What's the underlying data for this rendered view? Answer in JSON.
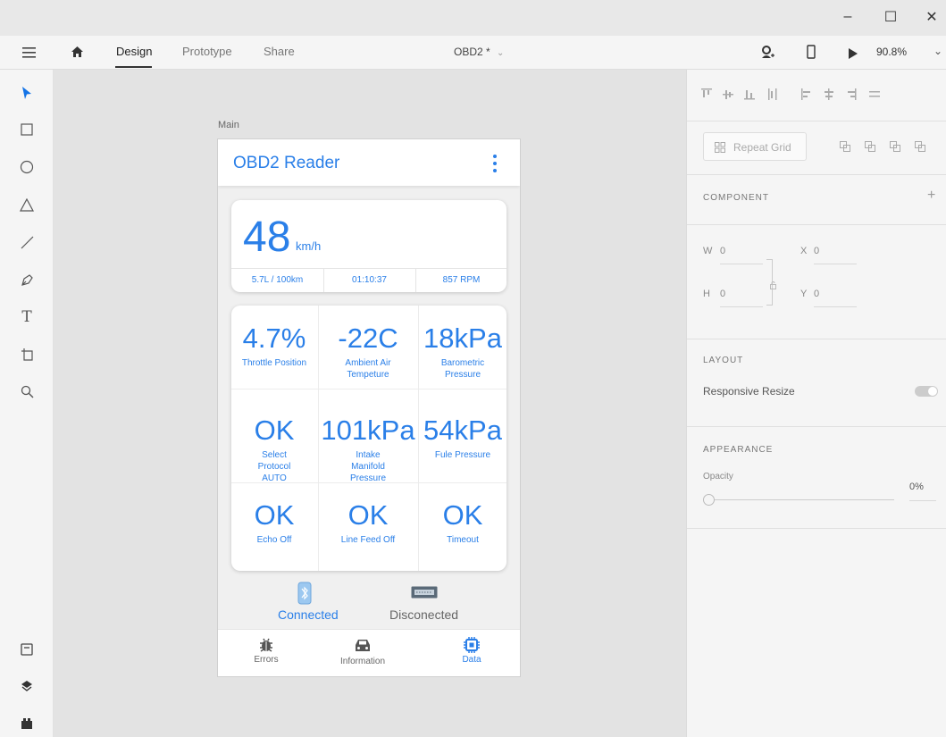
{
  "window": {
    "controls": {
      "minimize": "–",
      "maximize": "☐",
      "close": "✕"
    }
  },
  "menubar": {
    "tabs": [
      {
        "label": "Design"
      },
      {
        "label": "Prototype"
      },
      {
        "label": "Share"
      }
    ],
    "document_title": "OBD2 *",
    "zoom": "90.8%"
  },
  "canvas": {
    "artboard_name": "Main"
  },
  "app": {
    "title": "OBD2 Reader",
    "speed": {
      "value": "48",
      "unit": "km/h"
    },
    "stats": [
      "5.7L / 100km",
      "01:10:37",
      "857 RPM"
    ],
    "grid": [
      {
        "value": "4.7%",
        "caption": "Throttle Position"
      },
      {
        "value": "-22C",
        "caption": "Ambient Air Tempeture"
      },
      {
        "value": "18kPa",
        "caption": "Barometric Pressure"
      },
      {
        "value": "OK",
        "caption": "Select Protocol AUTO"
      },
      {
        "value": "101kPa",
        "caption": "Intake Manifold Pressure"
      },
      {
        "value": "54kPa",
        "caption": "Fule Pressure"
      },
      {
        "value": "OK",
        "caption": "Echo Off"
      },
      {
        "value": "OK",
        "caption": "Line Feed Off"
      },
      {
        "value": "OK",
        "caption": "Timeout"
      }
    ],
    "connection": {
      "connected": "Connected",
      "disconnected": "Disconected"
    },
    "nav": [
      {
        "label": "Errors"
      },
      {
        "label": "Information"
      },
      {
        "label": "Data"
      }
    ]
  },
  "right_panel": {
    "repeat_grid": "Repeat Grid",
    "component": "COMPONENT",
    "w_label": "W",
    "w_value": "0",
    "x_label": "X",
    "x_value": "0",
    "h_label": "H",
    "h_value": "0",
    "y_label": "Y",
    "y_value": "0",
    "layout": "LAYOUT",
    "responsive_resize": "Responsive Resize",
    "appearance": "APPEARANCE",
    "opacity_label": "Opacity",
    "opacity_value": "0%"
  },
  "colors": {
    "accent": "#2a7fe8",
    "toolbar_select": "#1473e6"
  }
}
